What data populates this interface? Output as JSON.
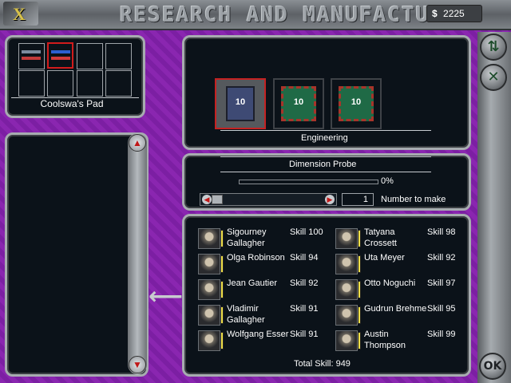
{
  "header": {
    "logo_letter": "X",
    "title": "RESEARCH AND MANUFACTURE",
    "currency_symbol": "$",
    "funds": "2225"
  },
  "pad": {
    "name": "Coolswa's Pad"
  },
  "project": {
    "category": "Engineering",
    "items": [
      {
        "count": "10"
      },
      {
        "count": "10"
      },
      {
        "count": "10"
      }
    ],
    "selected_name": "Dimension Probe",
    "progress_text": "0%",
    "progress": 0,
    "number": "1",
    "number_label": "Number to make"
  },
  "staff": [
    {
      "name": "Sigourney Gallagher",
      "skill": "Skill 100"
    },
    {
      "name": "Tatyana Crossett",
      "skill": "Skill 98"
    },
    {
      "name": "Olga Robinson",
      "skill": "Skill 94"
    },
    {
      "name": "Uta Meyer",
      "skill": "Skill 92"
    },
    {
      "name": "Jean Gautier",
      "skill": "Skill 92"
    },
    {
      "name": "Otto Noguchi",
      "skill": "Skill 97"
    },
    {
      "name": "Vladimir Gallagher",
      "skill": "Skill 91"
    },
    {
      "name": "Gudrun Brehme",
      "skill": "Skill 95"
    },
    {
      "name": "Wolfgang Esser",
      "skill": "Skill 91"
    },
    {
      "name": "Austin Thompson",
      "skill": "Skill 99"
    }
  ],
  "total_skill": "Total Skill:  949",
  "buttons": {
    "ok": "OK",
    "transfer_icon": "swap-arrows-icon",
    "dismiss_icon": "cross-x-icon"
  },
  "colors": {
    "background": "#8a26b0",
    "panel": "#0b1219",
    "frame": "#a7acb0",
    "selection": "#d21c1c",
    "skill_meter": "#f1e14b"
  }
}
